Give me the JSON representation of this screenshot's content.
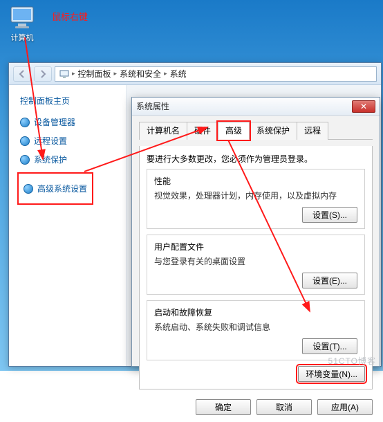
{
  "annotation": {
    "right_click_hint": "鼠标右键"
  },
  "desktop": {
    "computer_icon_label": "计算机"
  },
  "explorer": {
    "breadcrumb": {
      "root_icon": "monitor",
      "items": [
        "控制面板",
        "系统和安全",
        "系统"
      ]
    },
    "sidebar": {
      "home": "控制面板主页",
      "links": {
        "device_manager": "设备管理器",
        "remote_settings": "远程设置",
        "system_protection": "系统保护",
        "advanced_settings": "高级系统设置"
      }
    }
  },
  "sysdlg": {
    "title": "系统属性",
    "tabs": {
      "computer_name": "计算机名",
      "hardware": "硬件",
      "advanced": "高级",
      "system_protection": "系统保护",
      "remote": "远程"
    },
    "note": "要进行大多数更改，您必须作为管理员登录。",
    "groups": {
      "performance": {
        "title": "性能",
        "desc": "视觉效果，处理器计划，内存使用，以及虚拟内存",
        "button": "设置(S)..."
      },
      "user_profiles": {
        "title": "用户配置文件",
        "desc": "与您登录有关的桌面设置",
        "button": "设置(E)..."
      },
      "startup": {
        "title": "启动和故障恢复",
        "desc": "系统启动、系统失败和调试信息",
        "button": "设置(T)..."
      }
    },
    "env_button": "环境变量(N)...",
    "footer": {
      "ok": "确定",
      "cancel": "取消",
      "apply": "应用(A)"
    }
  },
  "watermark": "51CTO博客"
}
